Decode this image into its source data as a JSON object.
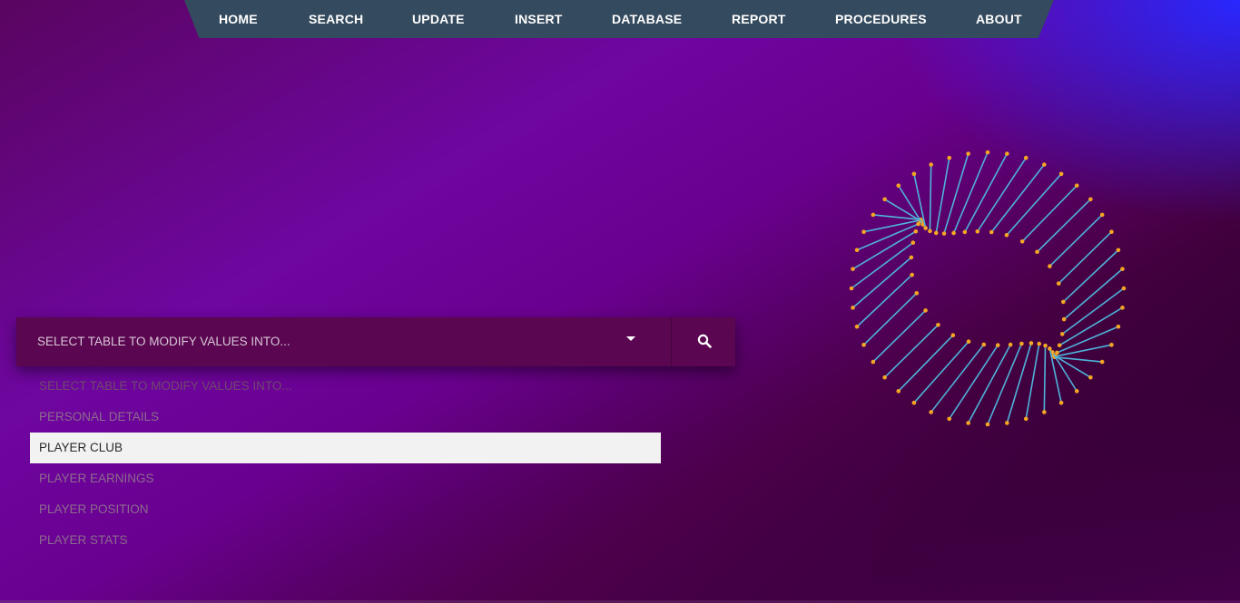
{
  "nav": {
    "items": [
      {
        "label": "HOME"
      },
      {
        "label": "SEARCH"
      },
      {
        "label": "UPDATE"
      },
      {
        "label": "INSERT"
      },
      {
        "label": "DATABASE"
      },
      {
        "label": "REPORT"
      },
      {
        "label": "PROCEDURES"
      },
      {
        "label": "ABOUT"
      }
    ]
  },
  "select": {
    "current_value": "SELECT TABLE TO MODIFY VALUES INTO...",
    "options": [
      {
        "label": "SELECT TABLE TO MODIFY VALUES INTO..."
      },
      {
        "label": "PERSONAL DETAILS"
      },
      {
        "label": "PLAYER CLUB"
      },
      {
        "label": "PLAYER EARNINGS"
      },
      {
        "label": "PLAYER POSITION"
      },
      {
        "label": "PLAYER STATS"
      }
    ],
    "highlighted_option": "PLAYER CLUB"
  },
  "icons": {
    "caret": "caret-down-icon",
    "search": "search-icon"
  },
  "colors": {
    "nav_bg": "#344a5e",
    "accent_line": "#4fb3d9",
    "accent_dot": "#f5a623",
    "highlight_bg": "#f3f2f2"
  }
}
